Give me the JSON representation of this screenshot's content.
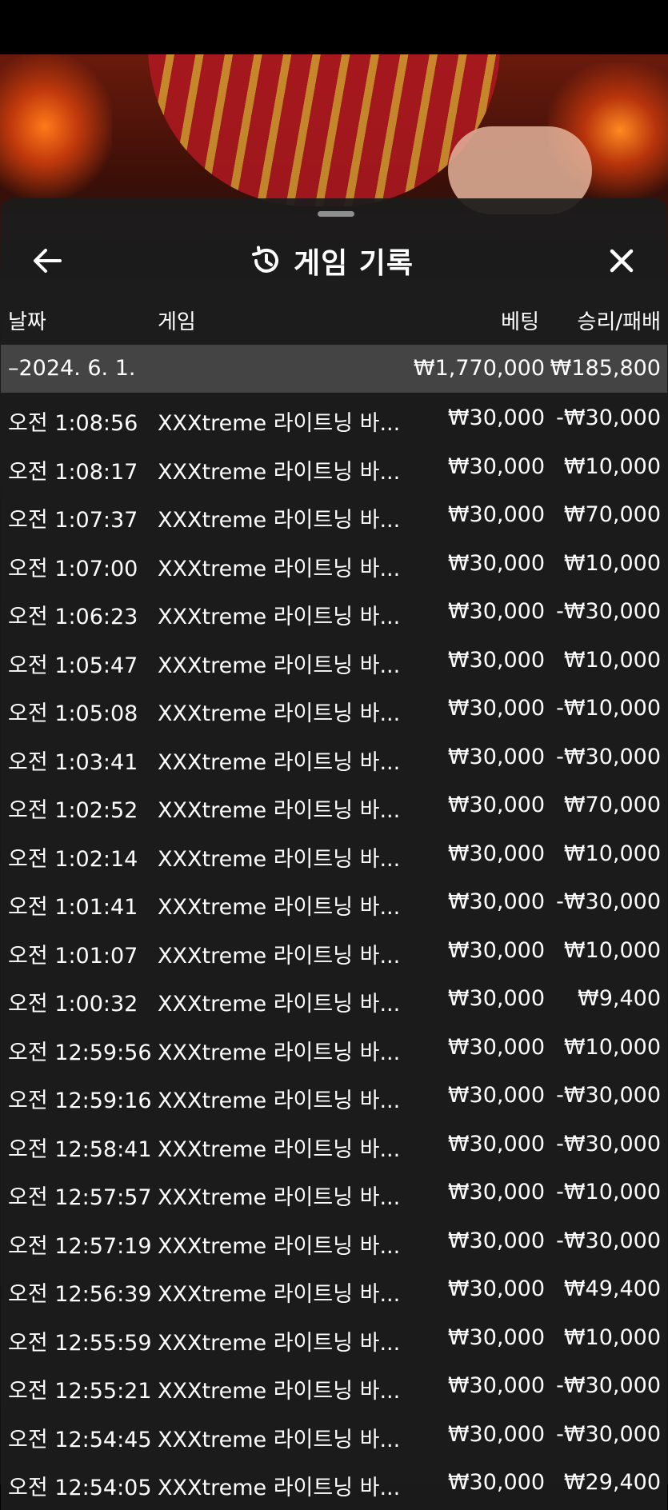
{
  "header": {
    "title": "게임 기록"
  },
  "columns": {
    "date": "날짜",
    "game": "게임",
    "bet": "베팅",
    "result": "승리/패배"
  },
  "summary": {
    "date": "–2024. 6. 1.",
    "bet": "₩1,770,000",
    "result": "₩185,800"
  },
  "rows": [
    {
      "time": "오전 1:08:56",
      "game": "XXXtreme 라이트닝 바...",
      "bet": "₩30,000",
      "result": "-₩30,000"
    },
    {
      "time": "오전 1:08:17",
      "game": "XXXtreme 라이트닝 바...",
      "bet": "₩30,000",
      "result": "₩10,000"
    },
    {
      "time": "오전 1:07:37",
      "game": "XXXtreme 라이트닝 바...",
      "bet": "₩30,000",
      "result": "₩70,000"
    },
    {
      "time": "오전 1:07:00",
      "game": "XXXtreme 라이트닝 바...",
      "bet": "₩30,000",
      "result": "₩10,000"
    },
    {
      "time": "오전 1:06:23",
      "game": "XXXtreme 라이트닝 바...",
      "bet": "₩30,000",
      "result": "-₩30,000"
    },
    {
      "time": "오전 1:05:47",
      "game": "XXXtreme 라이트닝 바...",
      "bet": "₩30,000",
      "result": "₩10,000"
    },
    {
      "time": "오전 1:05:08",
      "game": "XXXtreme 라이트닝 바...",
      "bet": "₩30,000",
      "result": "-₩10,000"
    },
    {
      "time": "오전 1:03:41",
      "game": "XXXtreme 라이트닝 바...",
      "bet": "₩30,000",
      "result": "-₩30,000"
    },
    {
      "time": "오전 1:02:52",
      "game": "XXXtreme 라이트닝 바...",
      "bet": "₩30,000",
      "result": "₩70,000"
    },
    {
      "time": "오전 1:02:14",
      "game": "XXXtreme 라이트닝 바...",
      "bet": "₩30,000",
      "result": "₩10,000"
    },
    {
      "time": "오전 1:01:41",
      "game": "XXXtreme 라이트닝 바...",
      "bet": "₩30,000",
      "result": "-₩30,000"
    },
    {
      "time": "오전 1:01:07",
      "game": "XXXtreme 라이트닝 바...",
      "bet": "₩30,000",
      "result": "₩10,000"
    },
    {
      "time": "오전 1:00:32",
      "game": "XXXtreme 라이트닝 바...",
      "bet": "₩30,000",
      "result": "₩9,400"
    },
    {
      "time": "오전 12:59:56",
      "game": "XXXtreme 라이트닝 바...",
      "bet": "₩30,000",
      "result": "₩10,000"
    },
    {
      "time": "오전 12:59:16",
      "game": "XXXtreme 라이트닝 바...",
      "bet": "₩30,000",
      "result": "-₩30,000"
    },
    {
      "time": "오전 12:58:41",
      "game": "XXXtreme 라이트닝 바...",
      "bet": "₩30,000",
      "result": "-₩30,000"
    },
    {
      "time": "오전 12:57:57",
      "game": "XXXtreme 라이트닝 바...",
      "bet": "₩30,000",
      "result": "-₩10,000"
    },
    {
      "time": "오전 12:57:19",
      "game": "XXXtreme 라이트닝 바...",
      "bet": "₩30,000",
      "result": "-₩30,000"
    },
    {
      "time": "오전 12:56:39",
      "game": "XXXtreme 라이트닝 바...",
      "bet": "₩30,000",
      "result": "₩49,400"
    },
    {
      "time": "오전 12:55:59",
      "game": "XXXtreme 라이트닝 바...",
      "bet": "₩30,000",
      "result": "₩10,000"
    },
    {
      "time": "오전 12:55:21",
      "game": "XXXtreme 라이트닝 바...",
      "bet": "₩30,000",
      "result": "-₩30,000"
    },
    {
      "time": "오전 12:54:45",
      "game": "XXXtreme 라이트닝 바...",
      "bet": "₩30,000",
      "result": "-₩30,000"
    },
    {
      "time": "오전 12:54:05",
      "game": "XXXtreme 라이트닝 바...",
      "bet": "₩30,000",
      "result": "₩29,400"
    }
  ]
}
